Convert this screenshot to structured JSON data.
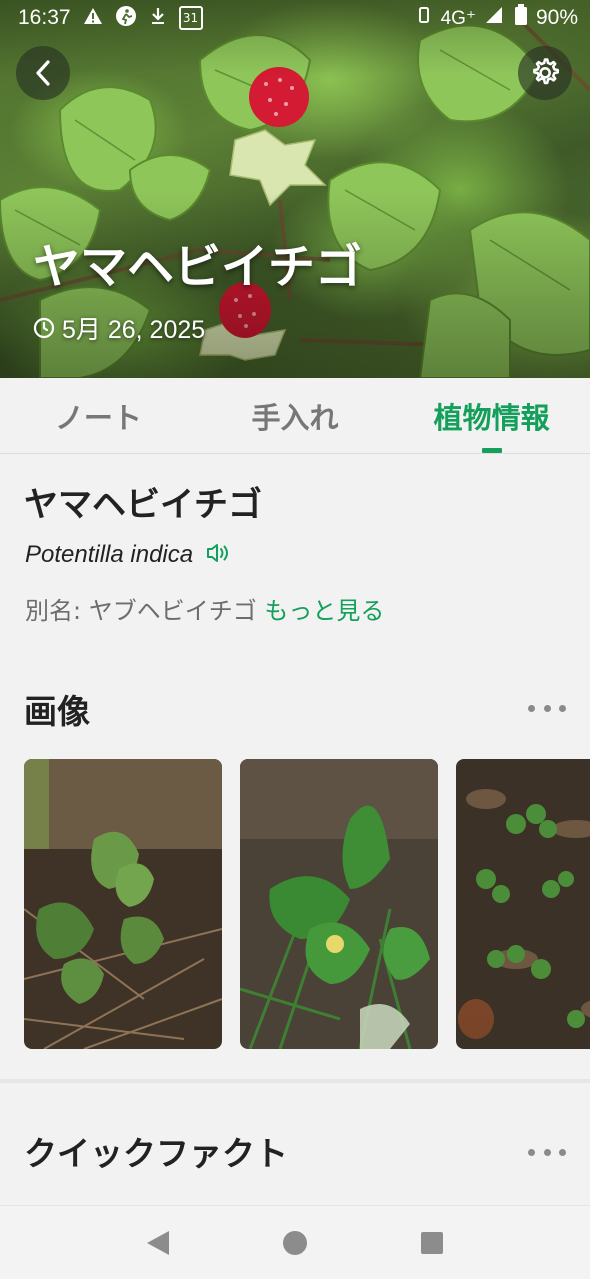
{
  "status_bar": {
    "time": "16:37",
    "battery": "90%",
    "network": "4G⁺",
    "icons": [
      "warning-icon",
      "running-icon",
      "download-icon",
      "calendar-icon",
      "vibrate-icon",
      "signal-icon",
      "battery-icon"
    ],
    "calendar_day": "31"
  },
  "hero": {
    "title": "ヤマヘビイチゴ",
    "date": "5月 26, 2025",
    "back_icon": "chevron-left-icon",
    "settings_icon": "gear-icon"
  },
  "tabs": [
    {
      "label": "ノート",
      "active": false
    },
    {
      "label": "手入れ",
      "active": false
    },
    {
      "label": "植物情報",
      "active": true
    }
  ],
  "plant_info": {
    "name": "ヤマヘビイチゴ",
    "scientific_name": "Potentilla indica",
    "alias_prefix": "別名: ヤブヘビイチゴ ",
    "more_link": "もっと見る"
  },
  "images_section": {
    "title": "画像",
    "thumbnails": [
      "plant-photo-1",
      "plant-photo-2",
      "plant-photo-3"
    ]
  },
  "quick_facts_section": {
    "title": "クイックファクト"
  },
  "colors": {
    "accent": "#14a05a",
    "background": "#f2f2f2",
    "muted_text": "#6d6d6d"
  },
  "nav_bar": [
    "back-triangle-icon",
    "home-circle-icon",
    "recents-square-icon"
  ]
}
